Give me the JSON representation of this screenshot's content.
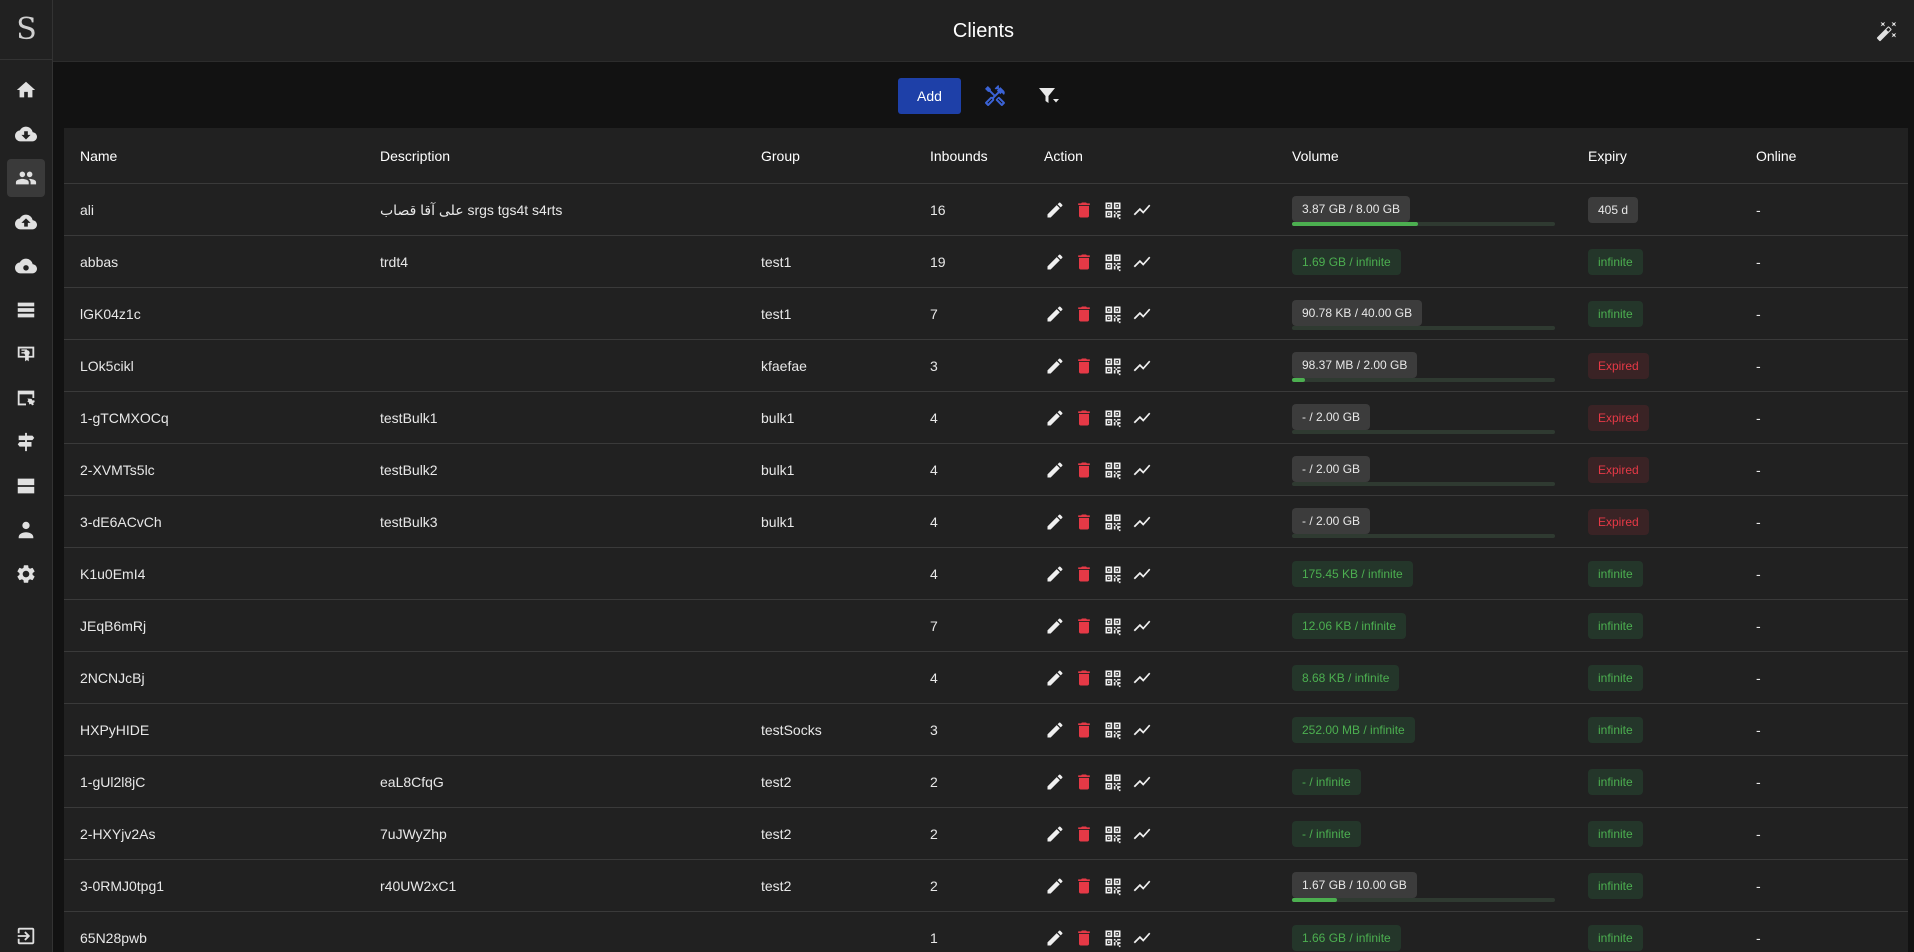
{
  "app": {
    "logo_letter": "S",
    "title": "Clients"
  },
  "sidebar": {
    "items": [
      {
        "icon": "home-icon",
        "active": false
      },
      {
        "icon": "cloud-download-icon",
        "active": false
      },
      {
        "icon": "users-icon",
        "active": true
      },
      {
        "icon": "cloud-upload-icon",
        "active": false
      },
      {
        "icon": "cloud-gear-icon",
        "active": false
      },
      {
        "icon": "server-list-icon",
        "active": false
      },
      {
        "icon": "certificate-icon",
        "active": false
      },
      {
        "icon": "browser-settings-icon",
        "active": false
      },
      {
        "icon": "signpost-icon",
        "active": false
      },
      {
        "icon": "servers-icon",
        "active": false
      },
      {
        "icon": "admin-icon",
        "active": false
      },
      {
        "icon": "gear-icon",
        "active": false
      },
      {
        "icon": "logout-icon",
        "active": false
      }
    ]
  },
  "toolbar": {
    "add_label": "Add"
  },
  "table": {
    "headers": {
      "name": "Name",
      "description": "Description",
      "group": "Group",
      "inbounds": "Inbounds",
      "action": "Action",
      "volume": "Volume",
      "expiry": "Expiry",
      "online": "Online"
    },
    "rows": [
      {
        "name": "ali",
        "description": "علی آقا قصاب srgs tgs4t s4rts",
        "group": "",
        "inbounds": "16",
        "volume": "3.87 GB / 8.00 GB",
        "volume_style": "grey",
        "usage_fraction": 0.48,
        "expiry": "405 d",
        "expiry_style": "grey",
        "online": "-"
      },
      {
        "name": "abbas",
        "description": "trdt4",
        "group": "test1",
        "inbounds": "19",
        "volume": "1.69 GB / infinite",
        "volume_style": "green",
        "usage_fraction": null,
        "expiry": "infinite",
        "expiry_style": "green",
        "online": "-"
      },
      {
        "name": "lGK04z1c",
        "description": "",
        "group": "test1",
        "inbounds": "7",
        "volume": "90.78 KB / 40.00 GB",
        "volume_style": "grey",
        "usage_fraction": 0.0,
        "expiry": "infinite",
        "expiry_style": "green",
        "online": "-"
      },
      {
        "name": "LOk5cikl",
        "description": "",
        "group": "kfaefae",
        "inbounds": "3",
        "volume": "98.37 MB / 2.00 GB",
        "volume_style": "grey",
        "usage_fraction": 0.05,
        "expiry": "Expired",
        "expiry_style": "red",
        "online": "-"
      },
      {
        "name": "1-gTCMXOCq",
        "description": "testBulk1",
        "group": "bulk1",
        "inbounds": "4",
        "volume": "- / 2.00 GB",
        "volume_style": "grey",
        "usage_fraction": 0.0,
        "expiry": "Expired",
        "expiry_style": "red",
        "online": "-"
      },
      {
        "name": "2-XVMTs5lc",
        "description": "testBulk2",
        "group": "bulk1",
        "inbounds": "4",
        "volume": "- / 2.00 GB",
        "volume_style": "grey",
        "usage_fraction": 0.0,
        "expiry": "Expired",
        "expiry_style": "red",
        "online": "-"
      },
      {
        "name": "3-dE6ACvCh",
        "description": "testBulk3",
        "group": "bulk1",
        "inbounds": "4",
        "volume": "- / 2.00 GB",
        "volume_style": "grey",
        "usage_fraction": 0.0,
        "expiry": "Expired",
        "expiry_style": "red",
        "online": "-"
      },
      {
        "name": "K1u0EmI4",
        "description": "",
        "group": "",
        "inbounds": "4",
        "volume": "175.45 KB / infinite",
        "volume_style": "green",
        "usage_fraction": null,
        "expiry": "infinite",
        "expiry_style": "green",
        "online": "-"
      },
      {
        "name": "JEqB6mRj",
        "description": "",
        "group": "",
        "inbounds": "7",
        "volume": "12.06 KB / infinite",
        "volume_style": "green",
        "usage_fraction": null,
        "expiry": "infinite",
        "expiry_style": "green",
        "online": "-"
      },
      {
        "name": "2NCNJcBj",
        "description": "",
        "group": "",
        "inbounds": "4",
        "volume": "8.68 KB / infinite",
        "volume_style": "green",
        "usage_fraction": null,
        "expiry": "infinite",
        "expiry_style": "green",
        "online": "-"
      },
      {
        "name": "HXPyHIDE",
        "description": "",
        "group": "testSocks",
        "inbounds": "3",
        "volume": "252.00 MB / infinite",
        "volume_style": "green",
        "usage_fraction": null,
        "expiry": "infinite",
        "expiry_style": "green",
        "online": "-"
      },
      {
        "name": "1-gUl2l8jC",
        "description": "eaL8CfqG",
        "group": "test2",
        "inbounds": "2",
        "volume": "- / infinite",
        "volume_style": "green",
        "usage_fraction": null,
        "expiry": "infinite",
        "expiry_style": "green",
        "online": "-"
      },
      {
        "name": "2-HXYjv2As",
        "description": "7uJWyZhp",
        "group": "test2",
        "inbounds": "2",
        "volume": "- / infinite",
        "volume_style": "green",
        "usage_fraction": null,
        "expiry": "infinite",
        "expiry_style": "green",
        "online": "-"
      },
      {
        "name": "3-0RMJ0tpg1",
        "description": "r40UW2xC1",
        "group": "test2",
        "inbounds": "2",
        "volume": "1.67 GB / 10.00 GB",
        "volume_style": "grey",
        "usage_fraction": 0.17,
        "expiry": "infinite",
        "expiry_style": "green",
        "online": "-"
      },
      {
        "name": "65N28pwb",
        "description": "",
        "group": "",
        "inbounds": "1",
        "volume": "1.66 GB / infinite",
        "volume_style": "green",
        "usage_fraction": null,
        "expiry": "infinite",
        "expiry_style": "green",
        "online": "-"
      }
    ]
  },
  "colors": {
    "accent": "#1e40a8",
    "success": "#4caf50",
    "danger": "#e53946",
    "surface": "#212121",
    "background": "#121212"
  }
}
